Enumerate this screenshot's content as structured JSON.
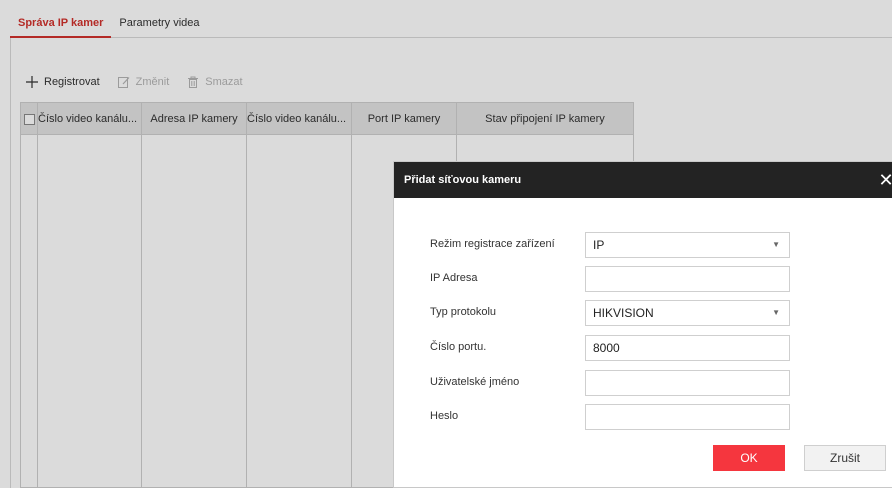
{
  "tabs": [
    {
      "label": "Správa IP kamer",
      "active": true
    },
    {
      "label": "Parametry videa",
      "active": false
    }
  ],
  "toolbar": {
    "register_label": "Registrovat",
    "modify_label": "Změnit",
    "delete_label": "Smazat"
  },
  "table": {
    "columns": [
      "Číslo video kanálu...",
      "Adresa IP kamery",
      "Číslo video kanálu...",
      "Port IP kamery",
      "Stav připojení IP kamery"
    ]
  },
  "dialog": {
    "title": "Přidat síťovou kameru",
    "close_glyph": "✕",
    "fields": {
      "registration_mode": {
        "label": "Režim registrace zařízení",
        "value": "IP"
      },
      "ip_address": {
        "label": "IP Adresa",
        "value": ""
      },
      "protocol_type": {
        "label": "Typ protokolu",
        "value": "HIKVISION"
      },
      "port_number": {
        "label": "Číslo portu.",
        "value": "8000"
      },
      "username": {
        "label": "Uživatelské jméno",
        "value": ""
      },
      "password": {
        "label": "Heslo",
        "value": ""
      }
    },
    "ok_label": "OK",
    "cancel_label": "Zrušit"
  },
  "colors": {
    "accent": "#d2322d",
    "ok_button": "#f5363e",
    "dialog_header": "#232323",
    "table_header": "#e3e3e3"
  },
  "icons": {
    "register": "plus-icon",
    "modify": "edit-icon",
    "delete": "trash-icon",
    "select": "caret-down-icon"
  }
}
